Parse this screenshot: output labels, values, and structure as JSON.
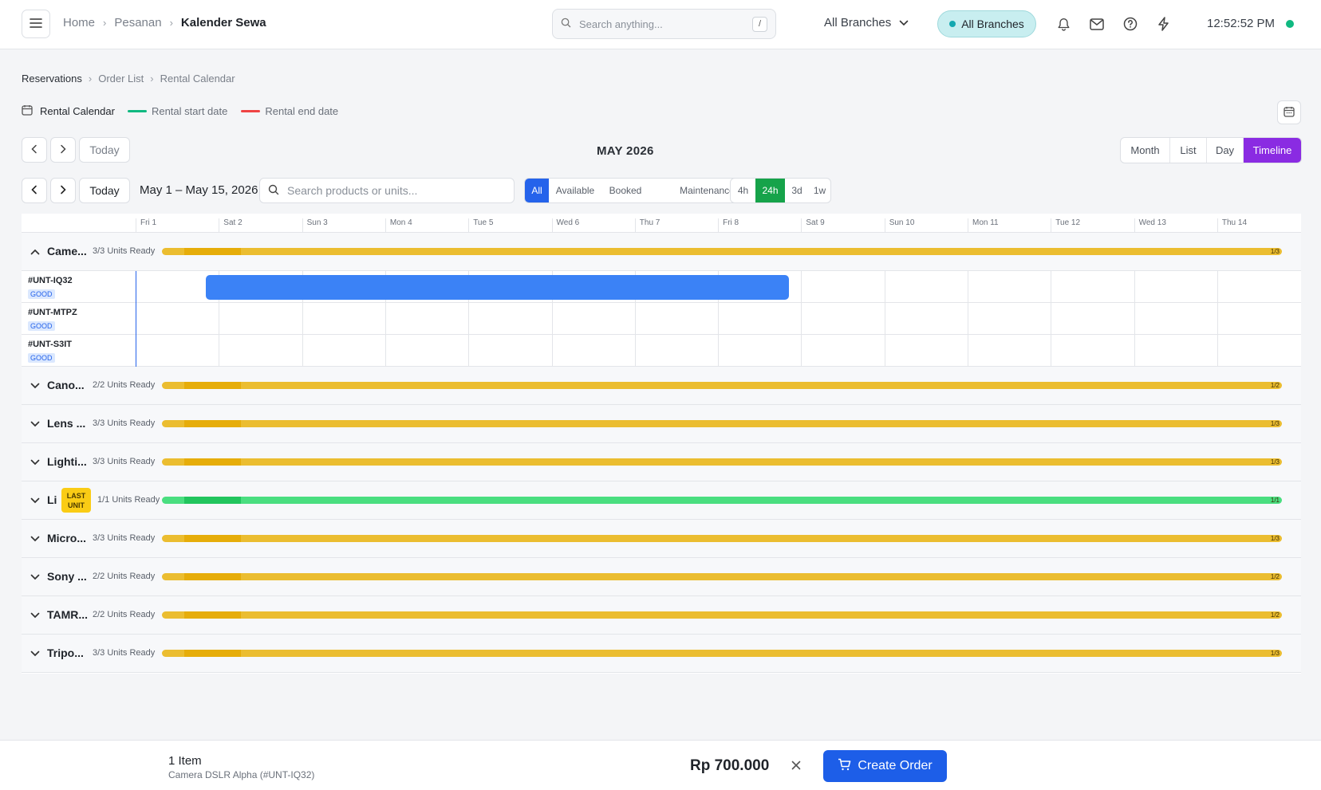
{
  "topbar": {
    "breadcrumb": [
      "Home",
      "Pesanan",
      "Kalender Sewa"
    ],
    "search_placeholder": "Search anything...",
    "search_shortcut": "/",
    "branch_select": "All Branches",
    "branch_pill": "All Branches",
    "clock": "12:52:52 PM",
    "icons": [
      "menu-icon",
      "bell-icon",
      "mail-icon",
      "help-icon",
      "lightning-icon"
    ]
  },
  "page": {
    "breadcrumb": [
      "Reservations",
      "Order List",
      "Rental Calendar"
    ],
    "legend_title": "Rental Calendar",
    "legend_start": "Rental start date",
    "legend_end": "Rental end date",
    "colors": {
      "start": "#10b981",
      "end": "#ef4444",
      "primary": "#2563eb",
      "timeline_active": "#8a2be2"
    }
  },
  "nav": {
    "today_label": "Today",
    "month_title": "MAY 2026",
    "views": [
      "Month",
      "List",
      "Day",
      "Timeline"
    ],
    "active_view": "Timeline",
    "range_label": "May 1 – May 15, 2026",
    "unit_search_placeholder": "Search products or units...",
    "status_filters": [
      "All",
      "Available",
      "Booked",
      "Maintenance"
    ],
    "active_status": "All",
    "zoom_options": [
      "4h",
      "24h",
      "3d",
      "1w"
    ],
    "active_zoom": "24h"
  },
  "timeline": {
    "days": [
      "Fri 1",
      "Sat 2",
      "Sun 3",
      "Mon 4",
      "Tue 5",
      "Wed 6",
      "Thu 7",
      "Fri 8",
      "Sat 9",
      "Sun 10",
      "Mon 11",
      "Tue 12",
      "Wed 13",
      "Thu 14"
    ],
    "groups": [
      {
        "name": "Came...",
        "ready": "3/3 Units Ready",
        "count": "1/3",
        "status": "partial",
        "expanded": true,
        "units": [
          {
            "code": "#UNT-IQ32",
            "condition": "GOOD",
            "booking": {
              "from_day": "Fri 1",
              "to_day": "Fri 8"
            }
          },
          {
            "code": "#UNT-MTPZ",
            "condition": "GOOD"
          },
          {
            "code": "#UNT-S3IT",
            "condition": "GOOD"
          }
        ]
      },
      {
        "name": "Cano...",
        "ready": "2/2 Units Ready",
        "count": "1/2",
        "status": "partial"
      },
      {
        "name": "Lens ...",
        "ready": "3/3 Units Ready",
        "count": "1/3",
        "status": "partial"
      },
      {
        "name": "Lighti...",
        "ready": "3/3 Units Ready",
        "count": "1/3",
        "status": "partial"
      },
      {
        "name": "Li",
        "badge": [
          "LAST",
          "UNIT"
        ],
        "ready": "1/1 Units Ready",
        "count": "1/1",
        "status": "full"
      },
      {
        "name": "Micro...",
        "ready": "3/3 Units Ready",
        "count": "1/3",
        "status": "partial"
      },
      {
        "name": "Sony ...",
        "ready": "2/2 Units Ready",
        "count": "1/2",
        "status": "partial"
      },
      {
        "name": "TAMR...",
        "ready": "2/2 Units Ready",
        "count": "1/2",
        "status": "partial"
      },
      {
        "name": "Tripo...",
        "ready": "3/3 Units Ready",
        "count": "1/3",
        "status": "partial"
      }
    ]
  },
  "footer": {
    "cart_count": "1 Item",
    "cart_item": "Camera DSLR Alpha (#UNT-IQ32)",
    "total": "Rp 700.000",
    "create_label": "Create Order"
  }
}
